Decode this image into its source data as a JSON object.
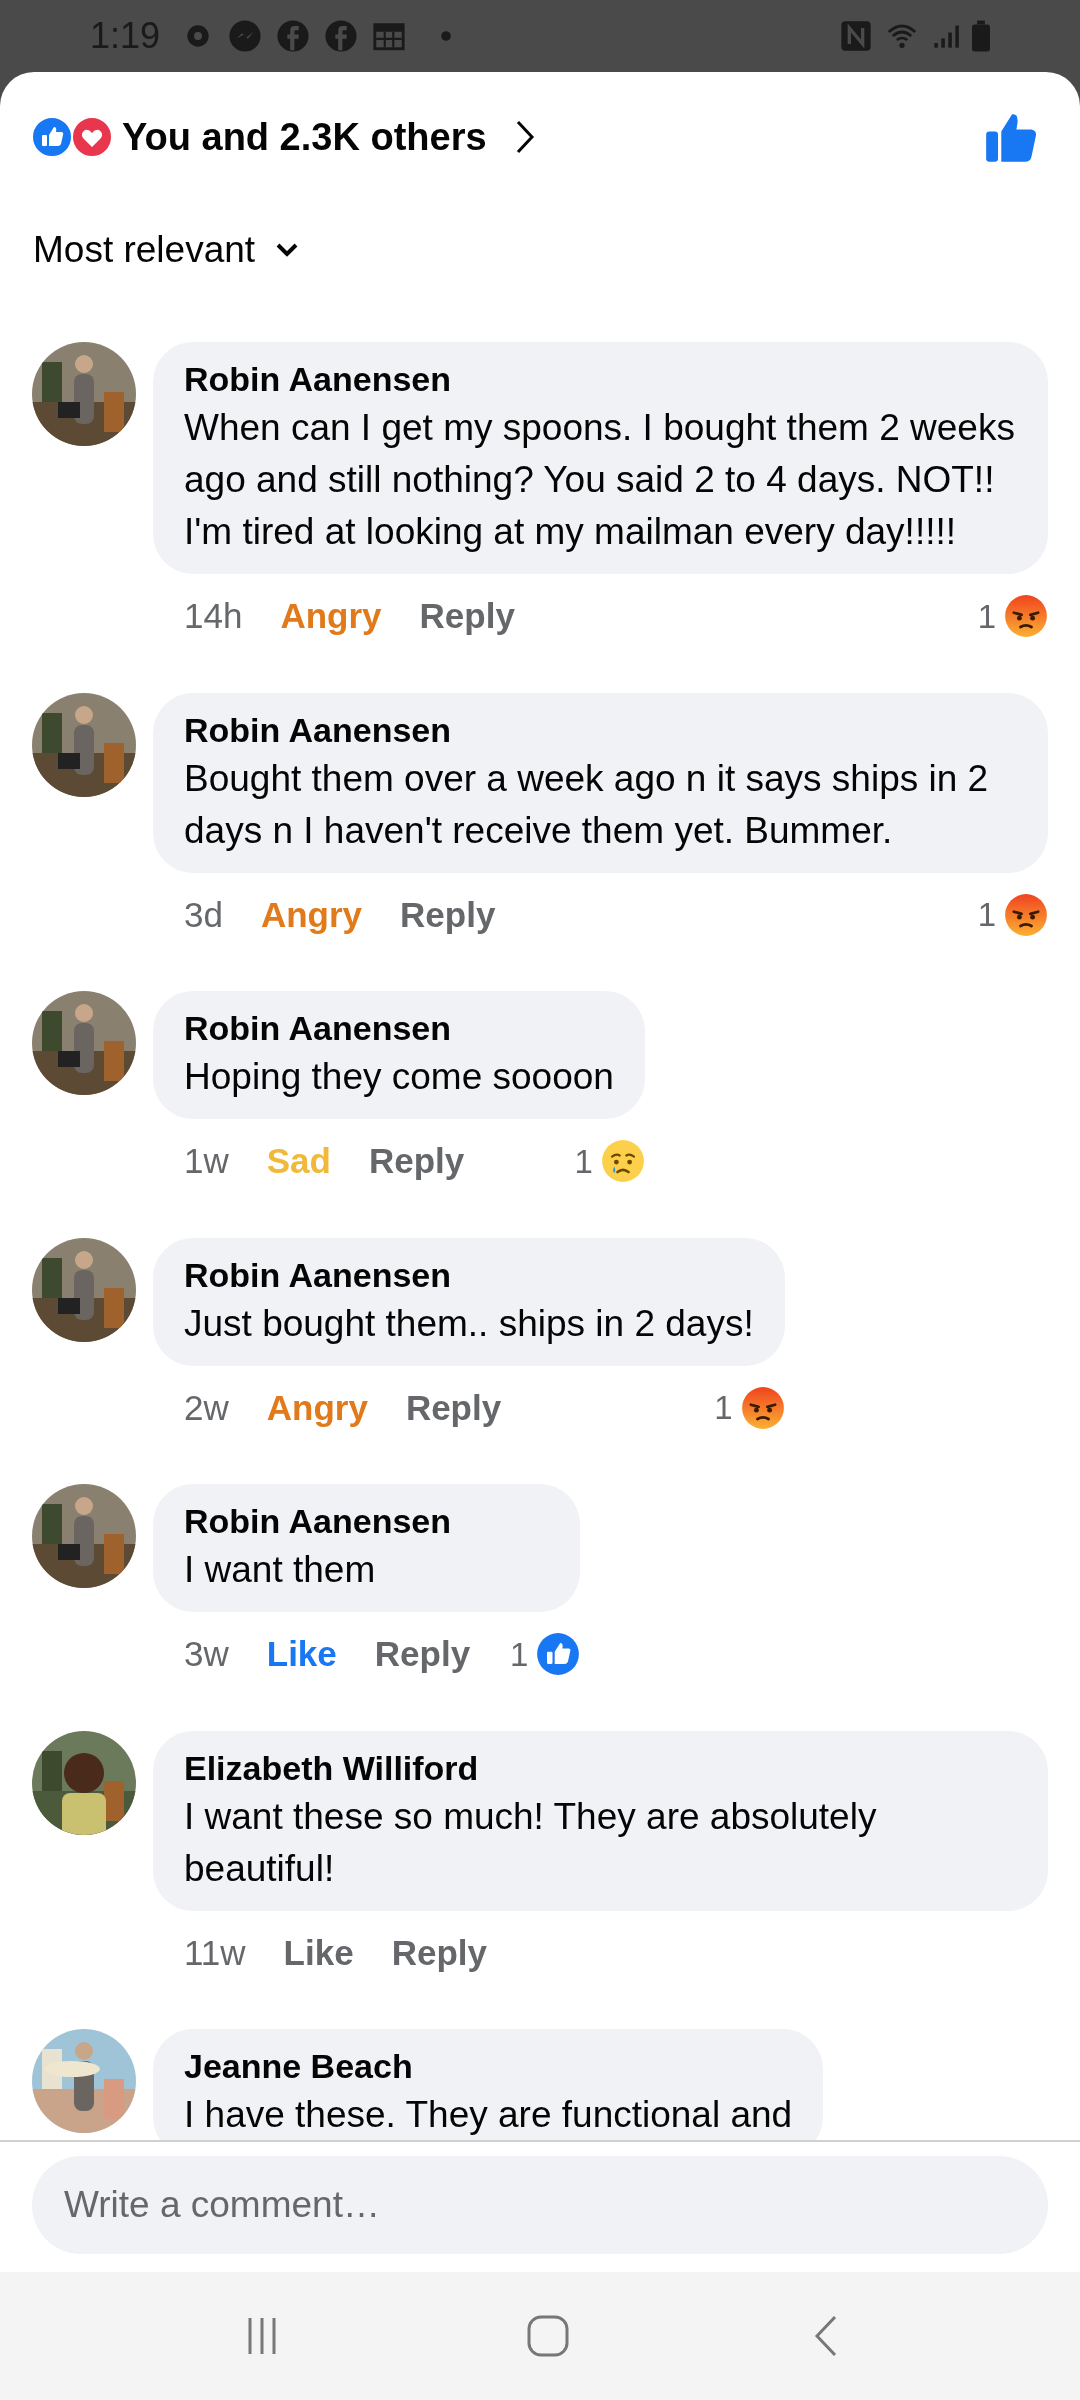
{
  "status_bar": {
    "time": "1:19"
  },
  "header": {
    "title": "You and 2.3K others",
    "liked": true
  },
  "sort": {
    "label": "Most relevant"
  },
  "comments": [
    {
      "author": "Robin Aanensen",
      "text": "When can I get my spoons. I bought them 2 weeks ago and still nothing? You said 2 to 4 days. NOT!!  I'm tired at looking at my mailman every day!!!!!",
      "time": "14h",
      "reaction": {
        "label": "Angry",
        "kind": "angry"
      },
      "reply": "Reply",
      "reaction_count": "1"
    },
    {
      "author": "Robin Aanensen",
      "text": "Bought them over a week ago n it says ships in 2 days n I haven't receive them yet. Bummer.",
      "time": "3d",
      "reaction": {
        "label": "Angry",
        "kind": "angry"
      },
      "reply": "Reply",
      "reaction_count": "1"
    },
    {
      "author": "Robin Aanensen",
      "text": "Hoping they come soooon",
      "time": "1w",
      "reaction": {
        "label": "Sad",
        "kind": "sad"
      },
      "reply": "Reply",
      "reaction_count": "1"
    },
    {
      "author": "Robin Aanensen",
      "text": "Just bought them.. ships in 2 days!",
      "time": "2w",
      "reaction": {
        "label": "Angry",
        "kind": "angry"
      },
      "reply": "Reply",
      "reaction_count": "1"
    },
    {
      "author": "Robin Aanensen",
      "text": "I want them",
      "time": "3w",
      "reaction": {
        "label": "Like",
        "kind": "like"
      },
      "reply": "Reply",
      "reaction_count": "1"
    },
    {
      "author": "Elizabeth Williford",
      "text": "I want these so much!  They are absolutely beautiful!",
      "time": "11w",
      "reaction": {
        "label": "Like",
        "kind": "none"
      },
      "reply": "Reply"
    },
    {
      "author": "Jeanne Beach",
      "text": "I have these. They are functional and"
    }
  ],
  "composer": {
    "placeholder": "Write a comment…"
  }
}
